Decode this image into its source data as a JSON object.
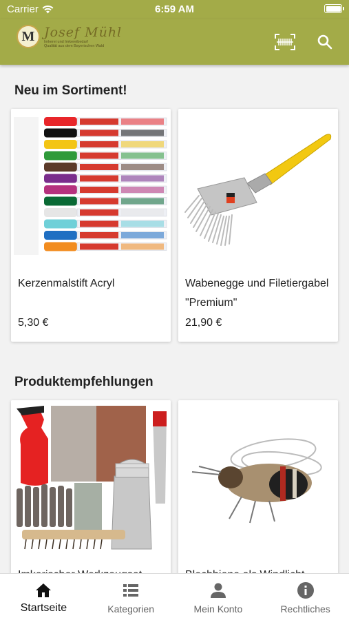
{
  "status_bar": {
    "carrier": "Carrier",
    "time": "6:59 AM"
  },
  "header": {
    "logo": {
      "letter": "M",
      "name": "Josef Mühl",
      "tagline_1": "Imkerei und Imkereibedarf",
      "tagline_2": "Qualität aus dem Bayerischen Wald"
    },
    "scan_icon": "barcode-scan-icon",
    "search_icon": "search-icon",
    "accent_color": "#a3ab48"
  },
  "sections": {
    "new": {
      "title": "Neu im Sortiment!",
      "products": [
        {
          "name": "Kerzenmalstift Acryl",
          "price": "5,30 €",
          "image": "acrylic-marker-pens"
        },
        {
          "name": "Wabenegge und Filetiergabel \"Premium\"",
          "price": "21,90 €",
          "image": "uncapping-fork"
        }
      ]
    },
    "recommended": {
      "title": "Produktempfehlungen",
      "products": [
        {
          "name": "Imkerischer Werkzeugset",
          "price": "",
          "image": "beekeeping-tool-set"
        },
        {
          "name": "Blechbiene als Windlicht",
          "price": "",
          "image": "metal-bee-figure"
        }
      ]
    }
  },
  "tabbar": {
    "tabs": [
      {
        "label": "Startseite",
        "icon": "home-icon",
        "active": true
      },
      {
        "label": "Kategorien",
        "icon": "list-icon",
        "active": false
      },
      {
        "label": "Mein Konto",
        "icon": "person-icon",
        "active": false
      },
      {
        "label": "Rechtliches",
        "icon": "info-icon",
        "active": false
      }
    ]
  }
}
